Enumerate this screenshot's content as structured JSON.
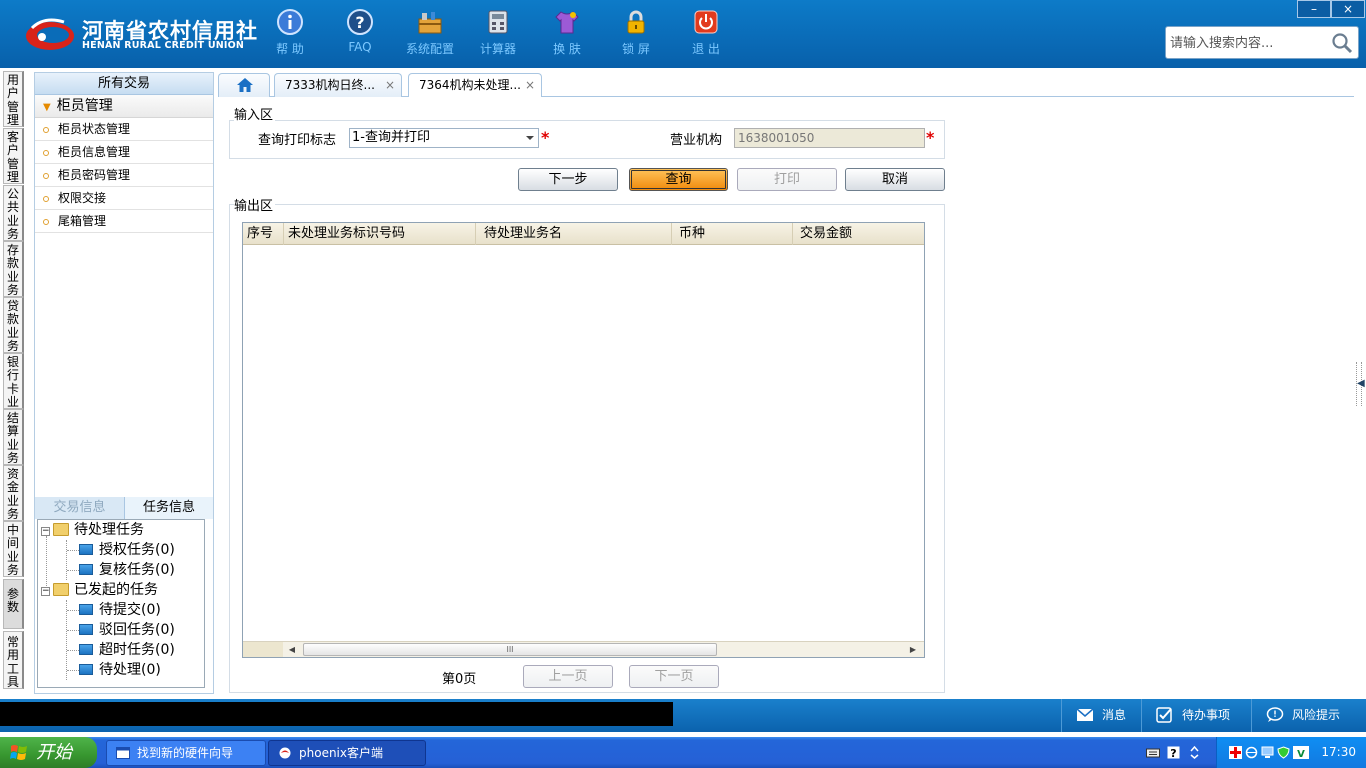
{
  "brand": {
    "name_cn": "河南省农村信用社",
    "name_en": "HENAN RURAL CREDIT UNION"
  },
  "toolbar": [
    {
      "label": "帮 助",
      "icon": "info-icon"
    },
    {
      "label": "FAQ",
      "icon": "question-icon"
    },
    {
      "label": "系统配置",
      "icon": "toolbox-icon"
    },
    {
      "label": "计算器",
      "icon": "calculator-icon"
    },
    {
      "label": "换 肤",
      "icon": "shirt-icon"
    },
    {
      "label": "锁 屏",
      "icon": "lock-icon"
    },
    {
      "label": "退 出",
      "icon": "power-icon"
    }
  ],
  "window_controls": {
    "minimize": "–",
    "close": "×"
  },
  "search": {
    "placeholder": "请输入搜索内容..."
  },
  "vertical_tabs": [
    {
      "label": "用户管理"
    },
    {
      "label": "客户管理"
    },
    {
      "label": "公共业务"
    },
    {
      "label": "存款业务"
    },
    {
      "label": "贷款业务"
    },
    {
      "label": "银行卡业务"
    },
    {
      "label": "结算业务"
    },
    {
      "label": "资金业务"
    },
    {
      "label": "中间业务"
    },
    {
      "label": "参数"
    },
    {
      "label": "常用工具"
    }
  ],
  "nav": {
    "header": "所有交易",
    "group": "柜员管理",
    "items": [
      "柜员状态管理",
      "柜员信息管理",
      "柜员密码管理",
      "权限交接",
      "尾箱管理"
    ]
  },
  "info_tabs": {
    "a": "交易信息",
    "b": "任务信息"
  },
  "tree": {
    "pending": "待处理任务",
    "pending_children": [
      "授权任务(0)",
      "复核任务(0)"
    ],
    "initiated": "已发起的任务",
    "initiated_children": [
      "待提交(0)",
      "驳回任务(0)",
      "超时任务(0)",
      "待处理(0)"
    ]
  },
  "doc_tabs": [
    "7333机构日终...",
    "7364机构未处理..."
  ],
  "form": {
    "input_section": "输入区",
    "output_section": "输出区",
    "query_flag_label": "查询打印标志",
    "query_flag_value": "1-查询并打印",
    "branch_label": "营业机构",
    "branch_value": "1638001050",
    "required_mark": "*"
  },
  "buttons": {
    "next": "下一步",
    "query": "查询",
    "print": "打印",
    "cancel": "取消",
    "prev_page": "上一页",
    "next_page": "下一页"
  },
  "grid": {
    "columns": [
      "序号",
      "未处理业务标识号码",
      "待处理业务名",
      "币种",
      "交易金额"
    ],
    "rows": [],
    "scroll_grip": "III"
  },
  "pager": {
    "label": "第0页"
  },
  "statusbar": [
    {
      "label": "消息",
      "icon": "mail-icon"
    },
    {
      "label": "待办事项",
      "icon": "checkbox-icon"
    },
    {
      "label": "风险提示",
      "icon": "speech-bubble-icon"
    }
  ],
  "taskbar": {
    "start": "开始",
    "tasks": [
      "找到新的硬件向导",
      "phoenix客户端"
    ],
    "clock": "17:30"
  },
  "colors": {
    "header_blue": "#0a6cb8",
    "accent_orange": "#f08a0c",
    "required_red": "#e00000"
  }
}
